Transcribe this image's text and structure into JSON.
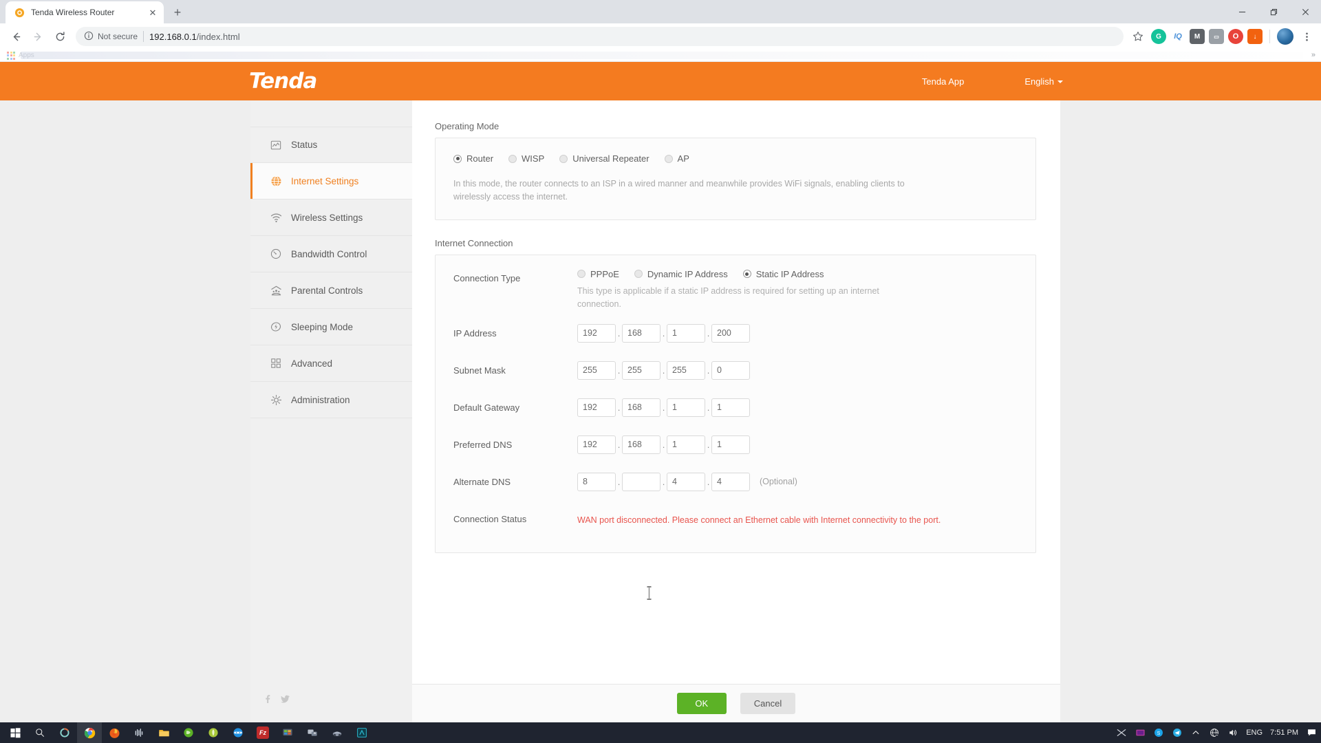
{
  "browser": {
    "tab": {
      "title": "Tenda Wireless Router",
      "favicon_name": "tenda-favicon",
      "close_glyph": "✕",
      "newtab_glyph": "+"
    },
    "window_controls": {
      "minimize": "–",
      "maximize": "❐",
      "close": "✕"
    },
    "nav": {
      "back": "←",
      "forward": "→",
      "reload": "↻"
    },
    "omnibox": {
      "security_label": "Not secure",
      "security_icon": "info-circle-icon",
      "url_host": "192.168.0.1",
      "url_path": "/index.html",
      "star_icon": "bookmark-star-icon"
    },
    "extensions": [
      {
        "name": "grammarly-extension",
        "glyph": "G",
        "color": "#15c39a"
      },
      {
        "name": "iq-extension",
        "glyph": "IQ",
        "color": "#4a90d9"
      },
      {
        "name": "mail-extension",
        "glyph": "M",
        "color": "#5f6368"
      },
      {
        "name": "capture-extension",
        "glyph": "▭",
        "color": "#9aa0a6"
      },
      {
        "name": "opera-vpn-extension",
        "glyph": "O",
        "color": "#e8433a"
      },
      {
        "name": "downloader-extension",
        "glyph": "↓",
        "color": "#f2620f"
      }
    ],
    "profile_avatar": "user-avatar",
    "menu_icon": "three-dot-menu-icon",
    "bookmarks": {
      "apps_label": "Apps",
      "overflow_glyph": "»"
    }
  },
  "page_header": {
    "logo_text": "Tenda",
    "app_link": "Tenda App",
    "language": "English"
  },
  "sidebar": {
    "items": [
      {
        "label": "Status",
        "icon": "status-chart-icon",
        "active": false
      },
      {
        "label": "Internet Settings",
        "icon": "globe-icon",
        "active": true
      },
      {
        "label": "Wireless Settings",
        "icon": "wifi-icon",
        "active": false
      },
      {
        "label": "Bandwidth Control",
        "icon": "gauge-icon",
        "active": false
      },
      {
        "label": "Parental Controls",
        "icon": "family-icon",
        "active": false
      },
      {
        "label": "Sleeping Mode",
        "icon": "power-moon-icon",
        "active": false
      },
      {
        "label": "Advanced",
        "icon": "grid-squares-icon",
        "active": false
      },
      {
        "label": "Administration",
        "icon": "gear-icon",
        "active": false
      }
    ],
    "social": [
      {
        "name": "facebook-icon",
        "glyph": "f"
      },
      {
        "name": "twitter-icon",
        "glyph": "✉"
      }
    ]
  },
  "operating_mode": {
    "section_title": "Operating Mode",
    "options": [
      {
        "label": "Router",
        "selected": true
      },
      {
        "label": "WISP",
        "selected": false
      },
      {
        "label": "Universal Repeater",
        "selected": false
      },
      {
        "label": "AP",
        "selected": false
      }
    ],
    "description": "In this mode, the router connects to an ISP in a wired manner and meanwhile provides WiFi signals, enabling clients to wirelessly access the internet."
  },
  "internet_connection": {
    "section_title": "Internet Connection",
    "connection_type": {
      "label": "Connection Type",
      "options": [
        {
          "label": "PPPoE",
          "selected": false
        },
        {
          "label": "Dynamic IP Address",
          "selected": false
        },
        {
          "label": "Static IP Address",
          "selected": true
        }
      ],
      "description": "This type is applicable if a static IP address is required for setting up an internet connection."
    },
    "fields": [
      {
        "label": "IP Address",
        "octets": [
          "192",
          "168",
          "1",
          "200"
        ],
        "note": ""
      },
      {
        "label": "Subnet Mask",
        "octets": [
          "255",
          "255",
          "255",
          "0"
        ],
        "note": ""
      },
      {
        "label": "Default Gateway",
        "octets": [
          "192",
          "168",
          "1",
          "1"
        ],
        "note": ""
      },
      {
        "label": "Preferred DNS",
        "octets": [
          "192",
          "168",
          "1",
          "1"
        ],
        "note": ""
      },
      {
        "label": "Alternate DNS",
        "octets": [
          "8",
          "",
          "4",
          "4"
        ],
        "note": "(Optional)"
      }
    ],
    "status": {
      "label": "Connection Status",
      "message": "WAN port disconnected. Please connect an Ethernet cable with Internet connectivity to the port.",
      "color": "#e8544d"
    }
  },
  "footer": {
    "ok_label": "OK",
    "cancel_label": "Cancel"
  },
  "taskbar": {
    "start_icon": "windows-start-icon",
    "search_icon": "search-icon",
    "cortana_icon": "cortana-icon",
    "apps": [
      {
        "name": "chrome-taskbar-icon",
        "color": "#e8453c",
        "glyph": ""
      },
      {
        "name": "firefox-taskbar-icon",
        "color": "#e86a20",
        "glyph": ""
      },
      {
        "name": "audacity-taskbar-icon",
        "color": "#3a5a8c",
        "glyph": "▐▐"
      },
      {
        "name": "explorer-taskbar-icon",
        "color": "#f0b429",
        "glyph": ""
      },
      {
        "name": "nvidia-taskbar-icon",
        "color": "#4aa72a",
        "glyph": ""
      },
      {
        "name": "green-app-taskbar-icon",
        "color": "#a8c83a",
        "glyph": ""
      },
      {
        "name": "ninja-taskbar-icon",
        "color": "#1f8fe0",
        "glyph": ""
      },
      {
        "name": "filezilla-taskbar-icon",
        "color": "#bf2b2b",
        "glyph": "Fz"
      },
      {
        "name": "vmware-taskbar-icon",
        "color": "#4b5563",
        "glyph": ""
      },
      {
        "name": "remote-taskbar-icon",
        "color": "#5a6577",
        "glyph": ""
      },
      {
        "name": "racing-taskbar-icon",
        "color": "#6b7280",
        "glyph": ""
      },
      {
        "name": "teal-app-taskbar-icon",
        "color": "#1a8a9a",
        "glyph": "▣"
      },
      {
        "name": "xsplit-taskbar-icon",
        "color": "#9aa0a6",
        "glyph": "✖"
      },
      {
        "name": "obs-taskbar-icon",
        "color": "#b03a9a",
        "glyph": "■"
      },
      {
        "name": "skype-taskbar-icon",
        "color": "#1aa3e8",
        "glyph": "S"
      },
      {
        "name": "telegram-taskbar-icon",
        "color": "#2aabe2",
        "glyph": "➤"
      }
    ],
    "tray": {
      "chevron_icon": "show-hidden-icons-icon",
      "network_icon": "network-globe-icon",
      "volume_icon": "volume-icon",
      "language": "ENG",
      "time": "7:51 PM",
      "action_center_icon": "notifications-icon"
    }
  }
}
